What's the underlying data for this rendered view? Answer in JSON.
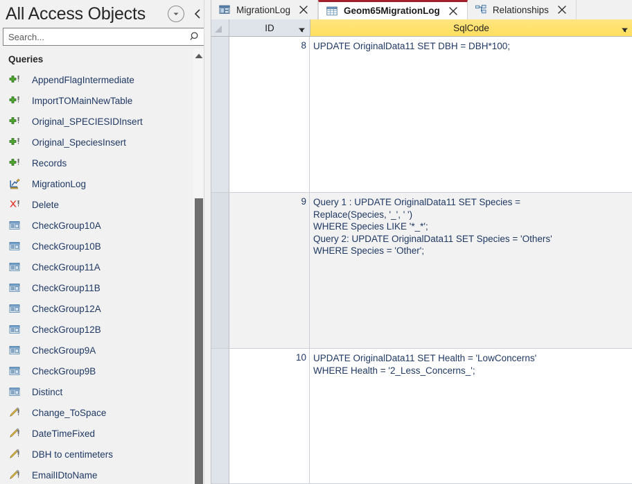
{
  "navpane": {
    "title": "All Access Objects",
    "dropdown_icon": "chevron-down-circle-icon",
    "shutter_icon": "chevron-left-icon",
    "search": {
      "value": "",
      "placeholder": "Search...",
      "icon": "search-icon"
    },
    "group": {
      "label": "Queries",
      "collapse_icon": "chevron-up-icon"
    },
    "items": [
      {
        "label": "AppendFlagIntermediate",
        "icon": "append-query-icon"
      },
      {
        "label": "ImportTOMainNewTable",
        "icon": "append-query-icon"
      },
      {
        "label": "Original_SPECIESIDInsert",
        "icon": "append-query-icon"
      },
      {
        "label": "Original_SpeciesInsert",
        "icon": "append-query-icon"
      },
      {
        "label": "Records",
        "icon": "append-query-icon"
      },
      {
        "label": "MigrationLog",
        "icon": "crosstab-query-icon"
      },
      {
        "label": "Delete",
        "icon": "delete-query-icon"
      },
      {
        "label": "CheckGroup10A",
        "icon": "select-query-icon"
      },
      {
        "label": "CheckGroup10B",
        "icon": "select-query-icon"
      },
      {
        "label": "CheckGroup11A",
        "icon": "select-query-icon"
      },
      {
        "label": "CheckGroup11B",
        "icon": "select-query-icon"
      },
      {
        "label": "CheckGroup12A",
        "icon": "select-query-icon"
      },
      {
        "label": "CheckGroup12B",
        "icon": "select-query-icon"
      },
      {
        "label": "CheckGroup9A",
        "icon": "select-query-icon"
      },
      {
        "label": "CheckGroup9B",
        "icon": "select-query-icon"
      },
      {
        "label": "Distinct",
        "icon": "select-query-icon"
      },
      {
        "label": "Change_ToSpace",
        "icon": "update-query-icon"
      },
      {
        "label": "DateTimeFixed",
        "icon": "update-query-icon"
      },
      {
        "label": "DBH to centimeters",
        "icon": "update-query-icon"
      },
      {
        "label": "EmailIDtoName",
        "icon": "update-query-icon"
      }
    ],
    "scrollbar": {
      "up_arrow_icon": "scroll-up-arrow-icon"
    }
  },
  "tabs": [
    {
      "label": "MigrationLog",
      "icon": "form-icon",
      "active": false,
      "close_icon": "close-icon"
    },
    {
      "label": "Geom65MigrationLog",
      "icon": "datasheet-icon",
      "active": true,
      "close_icon": "close-icon"
    },
    {
      "label": "Relationships",
      "icon": "relationships-icon",
      "active": false,
      "close_icon": "close-icon"
    }
  ],
  "datasheet": {
    "select_all_icon": "select-all-corner-icon",
    "columns": [
      {
        "key": "id",
        "label": "ID",
        "sort_icon": "filter-arrow-icon",
        "selected": false
      },
      {
        "key": "sql",
        "label": "SqlCode",
        "sort_icon": "filter-arrow-icon",
        "selected": true
      }
    ],
    "rows": [
      {
        "id": "8",
        "sql": "UPDATE OriginalData11 SET DBH = DBH*100;",
        "shade": "white"
      },
      {
        "id": "9",
        "sql": "Query 1 : UPDATE OriginalData11 SET Species =\nReplace(Species, '_', ' ')\nWHERE Species LIKE '*_*';\nQuery 2: UPDATE OriginalData11 SET Species = 'Others'\nWHERE  Species = 'Other';",
        "shade": "alt"
      },
      {
        "id": "10",
        "sql": "UPDATE OriginalData11 SET Health = 'LowConcerns'\nWHERE Health = '2_Less_Concerns_';",
        "shade": "white"
      }
    ]
  },
  "colors": {
    "accent_red": "#a4202a",
    "header_yellow": "#ffdf5e",
    "header_gray": "#dfe3ea",
    "text_blue": "#1f3864",
    "nav_bg": "#f1f1f1"
  }
}
